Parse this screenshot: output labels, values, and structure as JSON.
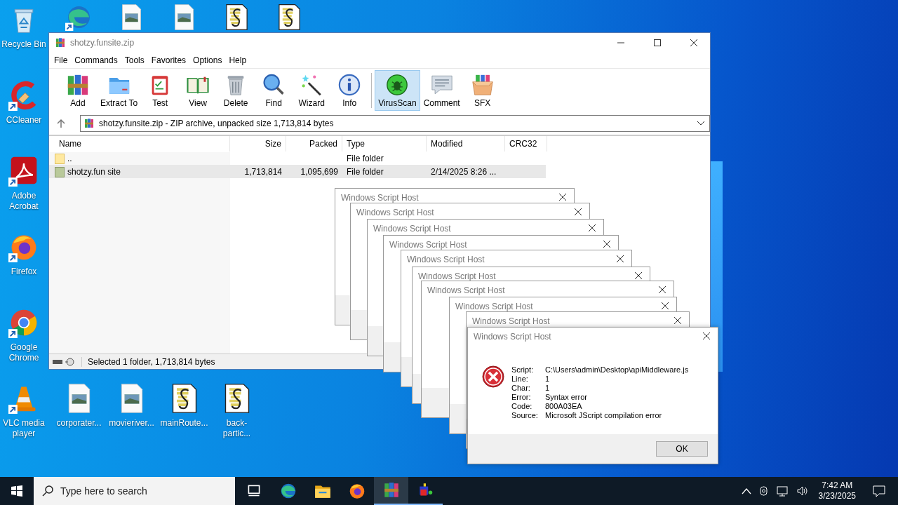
{
  "desktop": {
    "left_column": [
      {
        "kind": "recycle",
        "label": "Recycle Bin"
      },
      {
        "kind": "ccleaner",
        "label": "CCleaner"
      },
      {
        "kind": "acrobat",
        "label": "Adobe Acrobat"
      },
      {
        "kind": "firefox",
        "label": "Firefox"
      },
      {
        "kind": "chrome",
        "label": "Google Chrome"
      },
      {
        "kind": "vlc",
        "label": "VLC media player"
      }
    ],
    "top_row": [
      {
        "kind": "edge"
      },
      {
        "kind": "image"
      },
      {
        "kind": "image"
      },
      {
        "kind": "script"
      },
      {
        "kind": "script"
      }
    ],
    "bottom_row": [
      {
        "kind": "image",
        "label": "corporater..."
      },
      {
        "kind": "image",
        "label": "movieriver..."
      },
      {
        "kind": "script",
        "label": "mainRoute..."
      },
      {
        "kind": "script",
        "label": "back-partic..."
      }
    ]
  },
  "archive_window": {
    "title": "shotzy.funsite.zip",
    "menu": [
      "File",
      "Commands",
      "Tools",
      "Favorites",
      "Options",
      "Help"
    ],
    "toolbar": [
      {
        "kind": "add",
        "label": "Add",
        "selected": false
      },
      {
        "kind": "extract",
        "label": "Extract To",
        "selected": false
      },
      {
        "kind": "test",
        "label": "Test",
        "selected": false
      },
      {
        "kind": "view",
        "label": "View",
        "selected": false
      },
      {
        "kind": "delete",
        "label": "Delete",
        "selected": false
      },
      {
        "kind": "find",
        "label": "Find",
        "selected": false
      },
      {
        "kind": "wizard",
        "label": "Wizard",
        "selected": false
      },
      {
        "kind": "info",
        "label": "Info",
        "selected": false
      },
      {
        "kind": "virusscan",
        "label": "VirusScan",
        "selected": true
      },
      {
        "kind": "comment",
        "label": "Comment",
        "selected": false
      },
      {
        "kind": "sfx",
        "label": "SFX",
        "selected": false
      }
    ],
    "address": "shotzy.funsite.zip - ZIP archive, unpacked size 1,713,814 bytes",
    "columns": [
      "Name",
      "Size",
      "Packed",
      "Type",
      "Modified",
      "CRC32"
    ],
    "rows": [
      {
        "kind": "folder",
        "selected": false,
        "cells": [
          "..",
          "",
          "",
          "File folder",
          "",
          ""
        ]
      },
      {
        "kind": "archive_folder",
        "selected": true,
        "cells": [
          "shotzy.fun site",
          "1,713,814",
          "1,095,699",
          "File folder",
          "2/14/2025 8:26 ...",
          ""
        ]
      }
    ],
    "status": "Selected 1 folder, 1,713,814 bytes"
  },
  "background_dialogs": [
    {
      "title": "Windows Script Host"
    },
    {
      "title": "Windows Script Host"
    },
    {
      "title": "Windows Script Host"
    },
    {
      "title": "Windows Script Host"
    },
    {
      "title": "Windows Script Host"
    },
    {
      "title": "Windows Script Host"
    },
    {
      "title": "Windows Script Host"
    },
    {
      "title": "Windows Script Host"
    },
    {
      "title": "Windows Script Host"
    }
  ],
  "error_dialog": {
    "title": "Windows Script Host",
    "details": [
      {
        "label": "Script:",
        "value": "C:\\Users\\admin\\Desktop\\apiMiddleware.js"
      },
      {
        "label": "Line:",
        "value": "1"
      },
      {
        "label": "Char:",
        "value": "1"
      },
      {
        "label": "Error:",
        "value": "Syntax error"
      },
      {
        "label": "Code:",
        "value": "800A03EA"
      },
      {
        "label": "Source:",
        "value": "Microsoft JScript compilation error"
      }
    ],
    "button": "OK"
  },
  "taskbar": {
    "search_placeholder": "Type here to search",
    "apps": [
      {
        "kind": "taskview",
        "selected": false,
        "running": false
      },
      {
        "kind": "edge",
        "selected": false,
        "running": false
      },
      {
        "kind": "explorer",
        "selected": false,
        "running": false
      },
      {
        "kind": "firefox",
        "selected": false,
        "running": false
      },
      {
        "kind": "winrar",
        "selected": true,
        "running": true
      },
      {
        "kind": "app",
        "selected": false,
        "running": true
      }
    ],
    "time": "7:42 AM",
    "date": "3/23/2025"
  }
}
